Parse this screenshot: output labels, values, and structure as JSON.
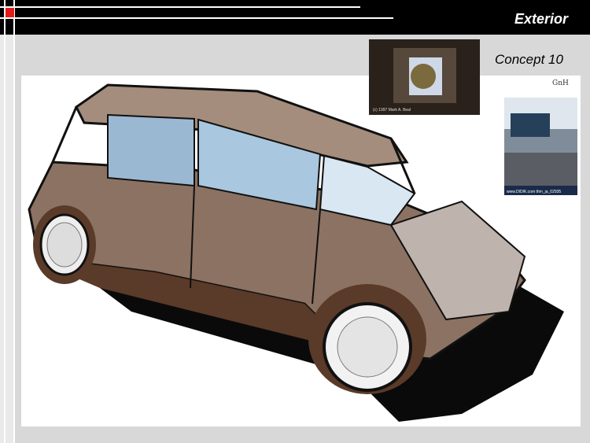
{
  "header": {
    "title": "Exterior"
  },
  "subtitle": "Concept 10",
  "images": {
    "sketch": "car-concept-sketch",
    "photo1": "atrium-photo",
    "photo1_caption": "(c) 1997 Mark A. Beal",
    "photo2": "building-photo",
    "photo2_caption": "www.DIDIK.com   thm_ja_02935"
  },
  "annotation": "GnH",
  "colors": {
    "bar": "#000000",
    "background": "#d8d8d8",
    "accent": "#e41b17"
  }
}
